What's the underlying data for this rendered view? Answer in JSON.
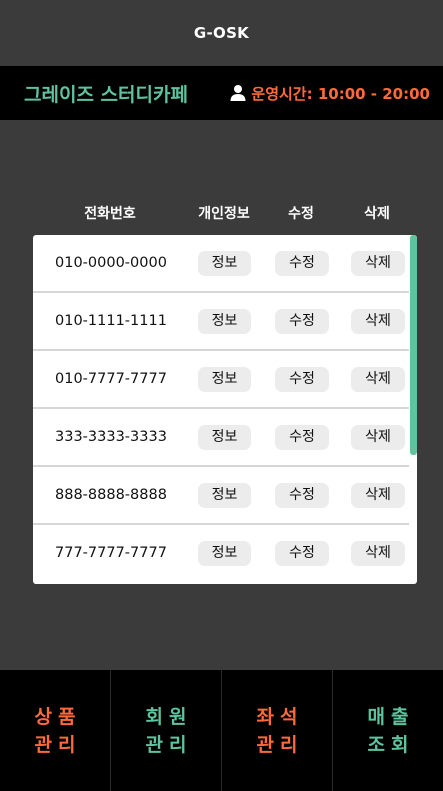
{
  "app": {
    "title": "G-OSK"
  },
  "header": {
    "store_name": "그레이즈 스터디카페",
    "hours": "운영시간: 10:00 - 20:00",
    "hours_icon": "user-icon",
    "store_color": "#5fc3a0",
    "hours_color": "#ff6a3c"
  },
  "table": {
    "columns": [
      "전화번호",
      "개인정보",
      "수정",
      "삭제"
    ],
    "rows": [
      {
        "phone": "010-0000-0000",
        "info": "정보",
        "edit": "수정",
        "delete": "삭제"
      },
      {
        "phone": "010-1111-1111",
        "info": "정보",
        "edit": "수정",
        "delete": "삭제"
      },
      {
        "phone": "010-7777-7777",
        "info": "정보",
        "edit": "수정",
        "delete": "삭제"
      },
      {
        "phone": "333-3333-3333",
        "info": "정보",
        "edit": "수정",
        "delete": "삭제"
      },
      {
        "phone": "888-8888-8888",
        "info": "정보",
        "edit": "수정",
        "delete": "삭제"
      },
      {
        "phone": "777-7777-7777",
        "info": "정보",
        "edit": "수정",
        "delete": "삭제"
      }
    ]
  },
  "nav": {
    "items": [
      {
        "line1": "상품",
        "line2": "관리",
        "color": "#ff6a3c"
      },
      {
        "line1": "회원",
        "line2": "관리",
        "color": "#5fc3a0"
      },
      {
        "line1": "좌석",
        "line2": "관리",
        "color": "#ff6a3c"
      },
      {
        "line1": "매출",
        "line2": "조회",
        "color": "#5fc3a0"
      }
    ]
  }
}
